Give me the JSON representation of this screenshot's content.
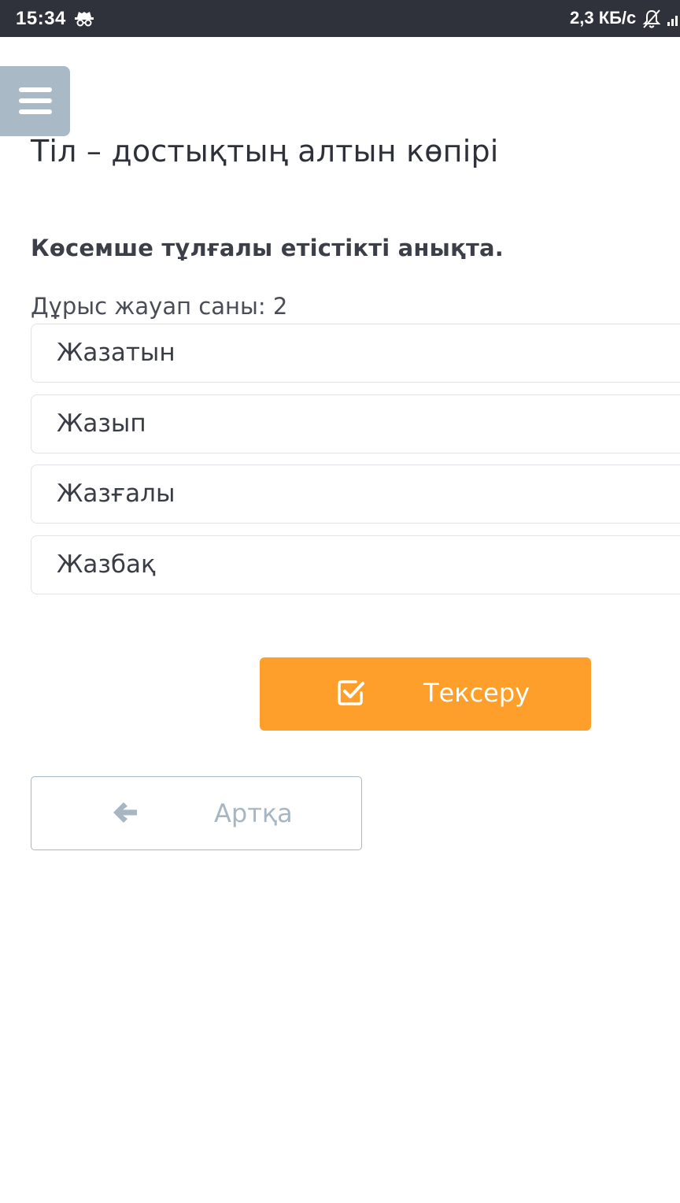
{
  "status_bar": {
    "time": "15:34",
    "network_speed": "2,3 КБ/с",
    "icons": [
      "incognito-icon",
      "bell-off-icon",
      "signal-icon"
    ]
  },
  "menu": {
    "icon": "hamburger-menu-icon"
  },
  "page": {
    "title": "Тіл – достықтың алтын көпірі"
  },
  "quiz": {
    "question": "Көсемше тұлғалы етістікті анықта.",
    "answer_count_text": "Дұрыс жауап саны: 2",
    "options": [
      {
        "label": "Жазатын"
      },
      {
        "label": "Жазып"
      },
      {
        "label": "Жазғалы"
      },
      {
        "label": "Жазбақ"
      }
    ]
  },
  "actions": {
    "check_label": "Тексеру",
    "check_icon": "checkbox-checked-icon",
    "back_label": "Артқа",
    "back_icon": "arrow-left-icon"
  },
  "colors": {
    "status_bar_bg": "#2f323b",
    "menu_bg": "#a9bac6",
    "primary_button": "#fe9f2b",
    "back_button_border": "#a6b7c3",
    "text_primary": "#2e3139"
  }
}
